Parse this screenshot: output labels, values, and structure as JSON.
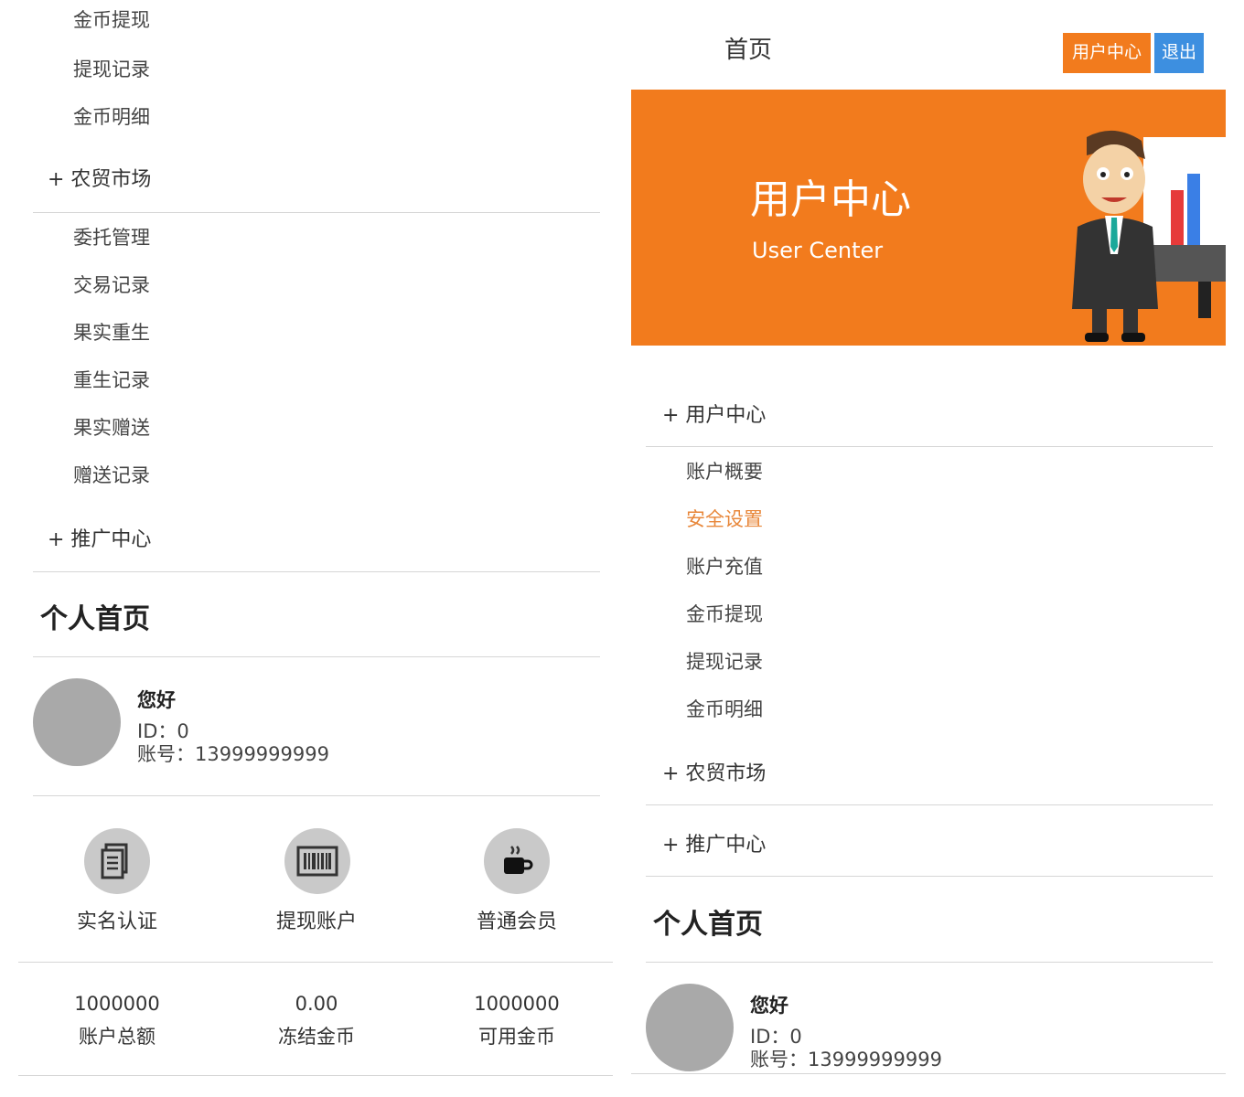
{
  "left": {
    "top_items": [
      "金币提现",
      "提现记录",
      "金币明细"
    ],
    "group_market": "+ 农贸市场",
    "market_items": [
      "委托管理",
      "交易记录",
      "果实重生",
      "重生记录",
      "果实赠送",
      "赠送记录"
    ],
    "group_promo": "+ 推广中心",
    "section_title": "个人首页",
    "profile": {
      "hello": "您好",
      "id_line": "ID：0",
      "account_line": "账号：13999999999"
    },
    "quick": [
      {
        "icon": "document-icon",
        "label": "实名认证"
      },
      {
        "icon": "barcode-icon",
        "label": "提现账户"
      },
      {
        "icon": "coffee-icon",
        "label": "普通会员"
      }
    ],
    "stats": [
      {
        "value": "1000000",
        "label": "账户总额"
      },
      {
        "value": "0.00",
        "label": "冻结金币"
      },
      {
        "value": "1000000",
        "label": "可用金币"
      }
    ]
  },
  "right": {
    "header": {
      "home": "首页",
      "user_center_btn": "用户中心",
      "logout_btn": "退出"
    },
    "banner": {
      "title": "用户中心",
      "subtitle": "User Center",
      "bg_color": "#f27b1d"
    },
    "group_user": "+ 用户中心",
    "user_items": [
      "账户概要",
      "安全设置",
      "账户充值",
      "金币提现",
      "提现记录",
      "金币明细"
    ],
    "active_item_color": "#e8873a",
    "group_market": "+ 农贸市场",
    "group_promo": "+ 推广中心",
    "section_title": "个人首页",
    "profile": {
      "hello": "您好",
      "id_line": "ID：0",
      "account_line": "账号：13999999999"
    }
  }
}
